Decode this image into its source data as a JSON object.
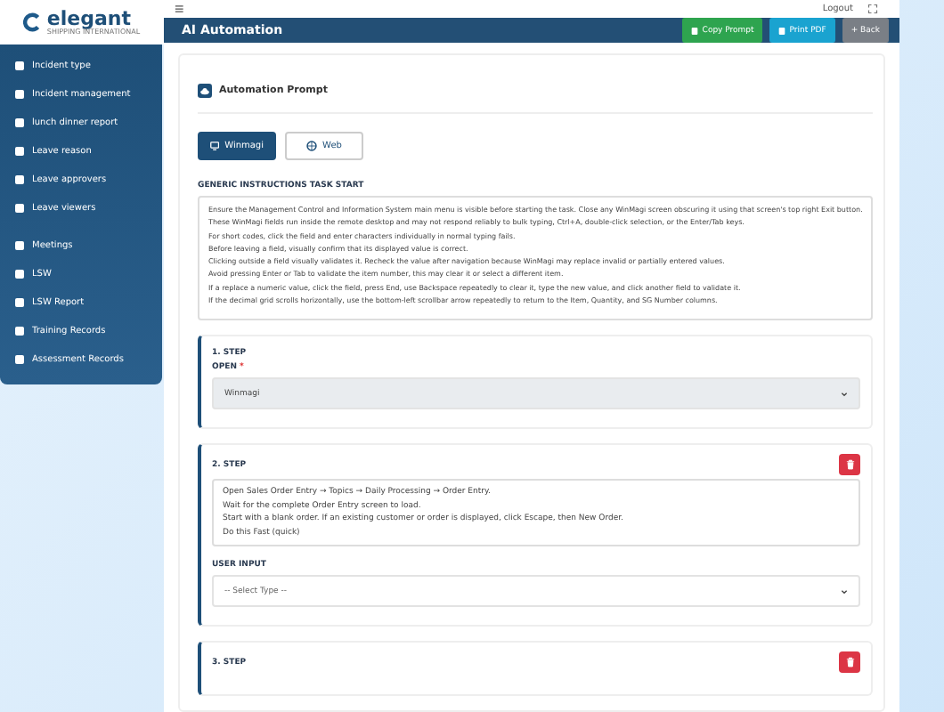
{
  "logo": {
    "name": "elegant",
    "tagline": "SHIPPING INTERNATIONAL"
  },
  "sidebar": {
    "items": [
      {
        "label": "Incident type"
      },
      {
        "label": "Incident management"
      },
      {
        "label": "lunch dinner report"
      },
      {
        "label": "Leave reason"
      },
      {
        "label": "Leave approvers"
      },
      {
        "label": "Leave viewers"
      },
      {
        "label": "Meetings"
      },
      {
        "label": "LSW"
      },
      {
        "label": "LSW Report"
      },
      {
        "label": "Training Records"
      },
      {
        "label": "Assessment Records"
      }
    ]
  },
  "topbar": {
    "menu": "≡",
    "logout": "Logout"
  },
  "header": {
    "title": "AI Automation",
    "buttons": [
      {
        "label": "Copy Prompt",
        "kind": "copy"
      },
      {
        "label": "Print PDF",
        "kind": "print"
      },
      {
        "label": "+ Back",
        "kind": "back"
      }
    ]
  },
  "card": {
    "title": "Automation Prompt",
    "tabs": [
      {
        "label": "Winmagi",
        "selected": true,
        "kind": "desktop"
      },
      {
        "label": "Web",
        "selected": false,
        "kind": "globe"
      }
    ],
    "instructions_label": "GENERIC INSTRUCTIONS TASK START",
    "instructions": [
      "Ensure the Management Control and Information System main menu is visible before starting the task. Close any WinMagi screen obscuring it using that screen's top right Exit button.",
      "These WinMagi fields run inside the remote desktop and may not respond reliably to bulk typing, Ctrl+A, double-click selection, or the Enter/Tab keys.",
      "For short codes, click the field and enter characters individually in normal typing fails.",
      "Before leaving a field, visually confirm that its displayed value is correct.",
      "Clicking outside a field visually validates it. Recheck the value after navigation because WinMagi may replace invalid or partially entered values.",
      "Avoid pressing Enter or Tab to validate the item number, this may clear it or select a different item.",
      "If a replace a numeric value, click the field, press End, use Backspace repeatedly to clear it, type the new value, and click another field to validate it.",
      "If the decimal grid scrolls horizontally, use the bottom-left scrollbar arrow repeatedly to return to the Item, Quantity, and SG Number columns."
    ]
  },
  "steps": [
    {
      "title": "1. STEP",
      "kind": "open",
      "field_label": "OPEN",
      "required": "*",
      "value": "Winmagi",
      "deletable": false
    },
    {
      "title": "2. STEP",
      "kind": "text",
      "deletable": true,
      "lines": [
        "Open Sales Order Entry → Topics → Daily Processing → Order Entry.",
        "Wait for the complete Order Entry screen to load.",
        "Start with a blank order. If an existing customer or order is displayed, click Escape, then New Order.",
        "Do this Fast (quick)"
      ],
      "input_label": "USER INPUT",
      "input_placeholder": "-- Select Type --"
    },
    {
      "title": "3. STEP",
      "kind": "text",
      "deletable": true
    }
  ]
}
